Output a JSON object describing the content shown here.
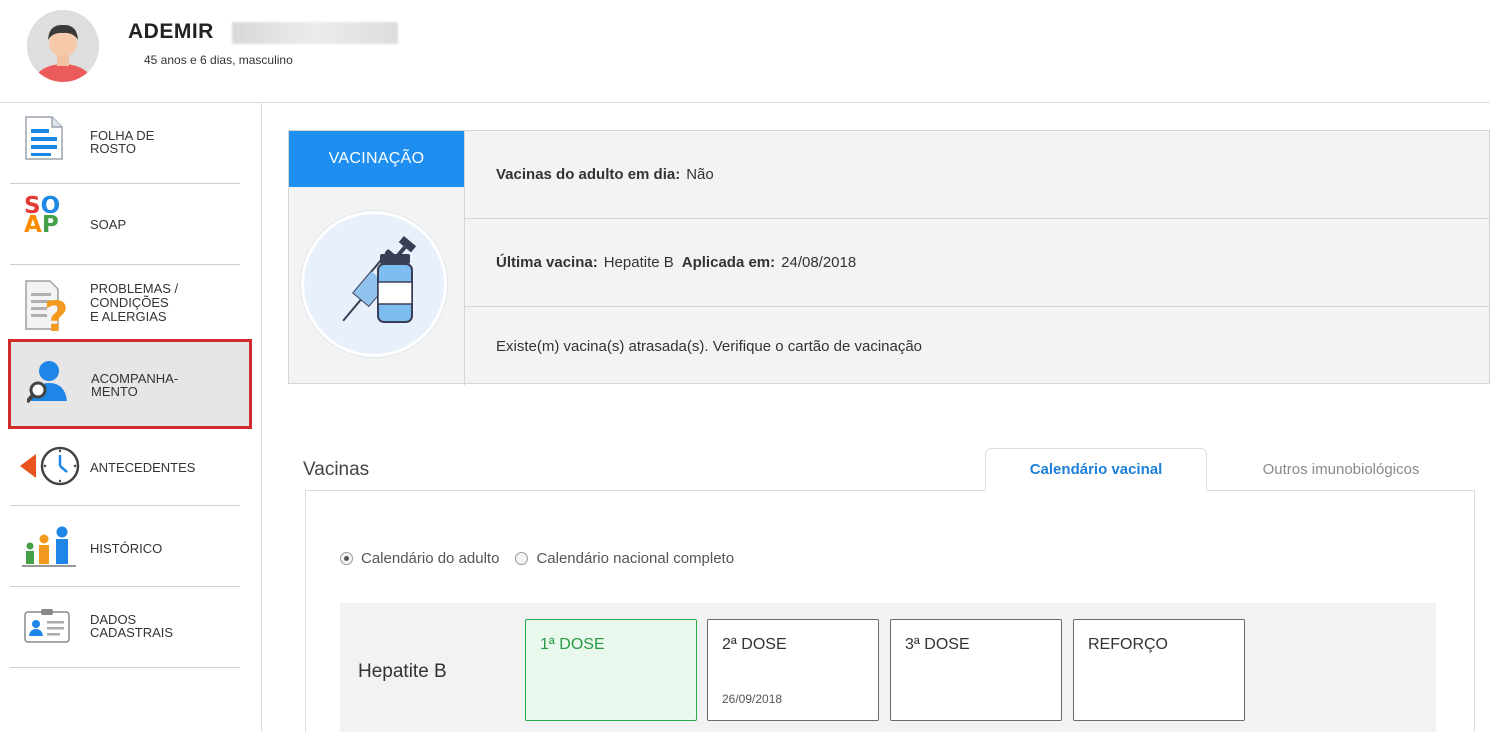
{
  "patient": {
    "name": "ADEMIR",
    "info": "45 anos e 6 dias, masculino"
  },
  "sidebar": {
    "items": [
      {
        "label": "FOLHA DE\nROSTO",
        "icon": "document-icon"
      },
      {
        "label": "SOAP",
        "icon": "soap-icon"
      },
      {
        "label": "PROBLEMAS /\nCONDIÇÕES\nE ALERGIAS",
        "icon": "question-document-icon"
      },
      {
        "label": "ACOMPANHA-\nMENTO",
        "icon": "user-search-icon"
      },
      {
        "label": "ANTECEDENTES",
        "icon": "clock-back-icon"
      },
      {
        "label": "HISTÓRICO",
        "icon": "family-icon"
      },
      {
        "label": "DADOS\nCADASTRAIS",
        "icon": "id-card-icon"
      }
    ],
    "active_index": 3
  },
  "vaccination": {
    "tab_label": "VACINAÇÃO",
    "row1_label": "Vacinas do adulto em dia:",
    "row1_value": "Não",
    "row2_label": "Última vacina:",
    "row2_value": "Hepatite B",
    "row2_label2": "Aplicada em:",
    "row2_value2": "24/08/2018",
    "row3_text": "Existe(m) vacina(s) atrasada(s). Verifique o cartão de vacinação"
  },
  "vacinas": {
    "title": "Vacinas",
    "tabs": [
      "Calendário vacinal",
      "Outros imunobiológicos"
    ],
    "radios": [
      {
        "label": "Calendário do adulto",
        "checked": true
      },
      {
        "label": "Calendário nacional completo",
        "checked": false
      }
    ],
    "vaccine_name": "Hepatite B",
    "doses": [
      {
        "label": "1ª DOSE",
        "date": "",
        "status": "done"
      },
      {
        "label": "2ª DOSE",
        "date": "26/09/2018",
        "status": "pending"
      },
      {
        "label": "3ª DOSE",
        "date": "",
        "status": "pending"
      },
      {
        "label": "REFORÇO",
        "date": "",
        "status": "pending"
      }
    ]
  },
  "colors": {
    "accent": "#1e8ef0",
    "active_border": "#d02a2a",
    "dose_done": "#2a9a47"
  }
}
